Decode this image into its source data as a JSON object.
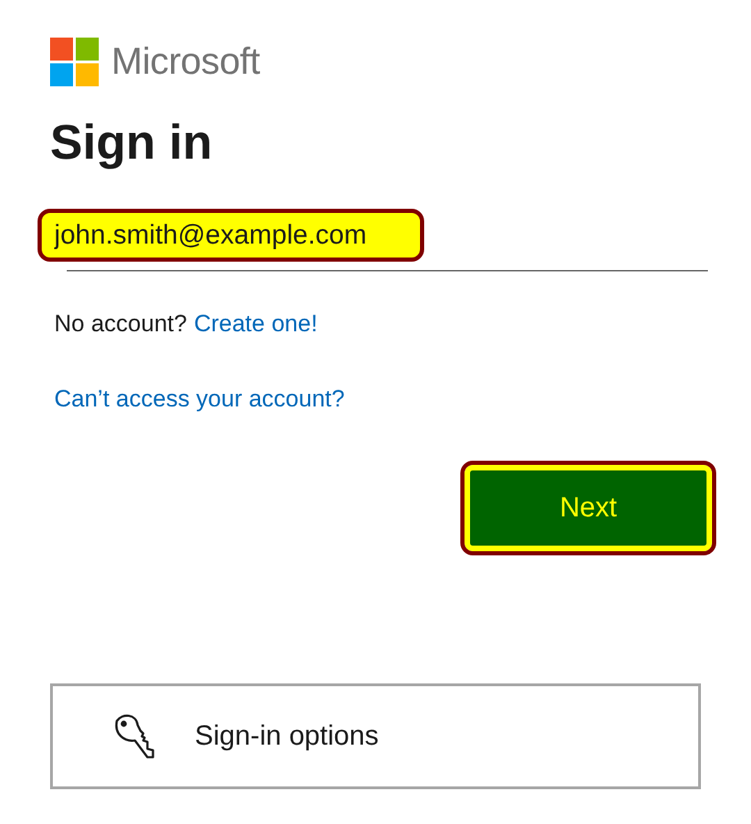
{
  "logo": {
    "text": "Microsoft"
  },
  "heading": "Sign in",
  "email_field": {
    "value": "john.smith@example.com"
  },
  "no_account": {
    "text": "No account?",
    "link": "Create one!"
  },
  "cant_access_link": "Can’t access your account?",
  "next_button": "Next",
  "sign_in_options": "Sign-in options"
}
